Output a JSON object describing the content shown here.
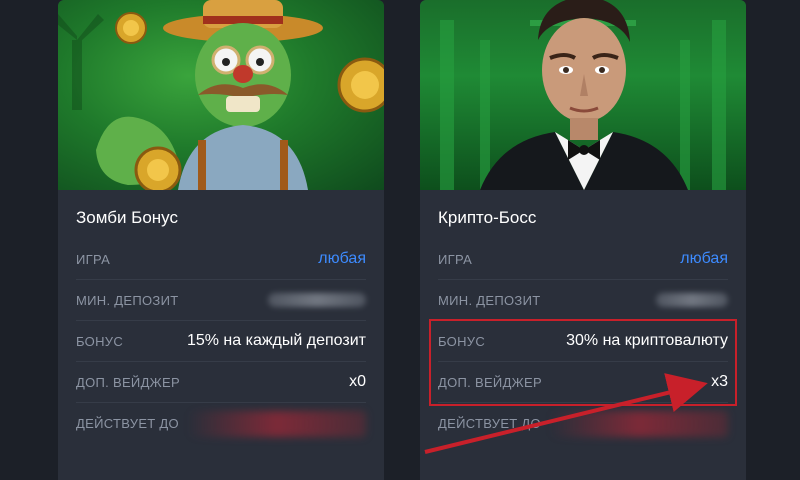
{
  "cards": [
    {
      "title": "Зомби Бонус",
      "image": "zombie-farmer-art",
      "rows": [
        {
          "label": "ИГРА",
          "value": "любая"
        },
        {
          "label": "МИН. ДЕПОЗИТ",
          "value": ""
        },
        {
          "label": "БОНУС",
          "value": "15% на каждый депозит"
        },
        {
          "label": "ДОП. ВЕЙДЖЕР",
          "value": "x0"
        },
        {
          "label": "ДЕЙСТВУЕТ ДО",
          "value": ""
        }
      ]
    },
    {
      "title": "Крипто-Босс",
      "image": "tuxedo-man-art",
      "rows": [
        {
          "label": "ИГРА",
          "value": "любая"
        },
        {
          "label": "МИН. ДЕПОЗИТ",
          "value": ""
        },
        {
          "label": "БОНУС",
          "value": "30% на криптовалюту"
        },
        {
          "label": "ДОП. ВЕЙДЖЕР",
          "value": "x3"
        },
        {
          "label": "ДЕЙСТВУЕТ ДО",
          "value": ""
        }
      ]
    }
  ],
  "colors": {
    "background": "#1c2028",
    "card": "#2a2f3a",
    "link": "#3d8bff",
    "highlight": "#c8202a"
  }
}
